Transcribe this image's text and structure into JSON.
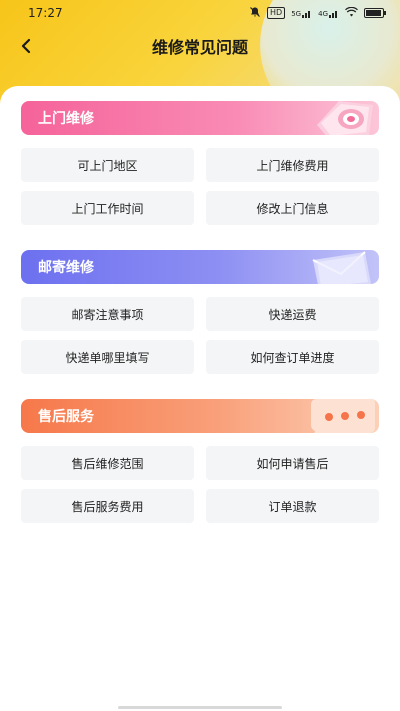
{
  "status_bar": {
    "time": "17:27",
    "hd_label": "HD",
    "net1": "5G",
    "net2": "4G"
  },
  "header": {
    "title": "维修常见问题"
  },
  "sections": [
    {
      "title": "上门维修",
      "gradient": [
        "#f5639a",
        "#fbb0ca"
      ],
      "items": [
        "可上门地区",
        "上门维修费用",
        "上门工作时间",
        "修改上门信息"
      ]
    },
    {
      "title": "邮寄维修",
      "gradient": [
        "#6f71f0",
        "#b4b2f7"
      ],
      "items": [
        "邮寄注意事项",
        "快递运费",
        "快递单哪里填写",
        "如何查订单进度"
      ]
    },
    {
      "title": "售后服务",
      "gradient": [
        "#f77a4a",
        "#fbc0a0"
      ],
      "items": [
        "售后维修范围",
        "如何申请售后",
        "售后服务费用",
        "订单退款"
      ]
    }
  ]
}
